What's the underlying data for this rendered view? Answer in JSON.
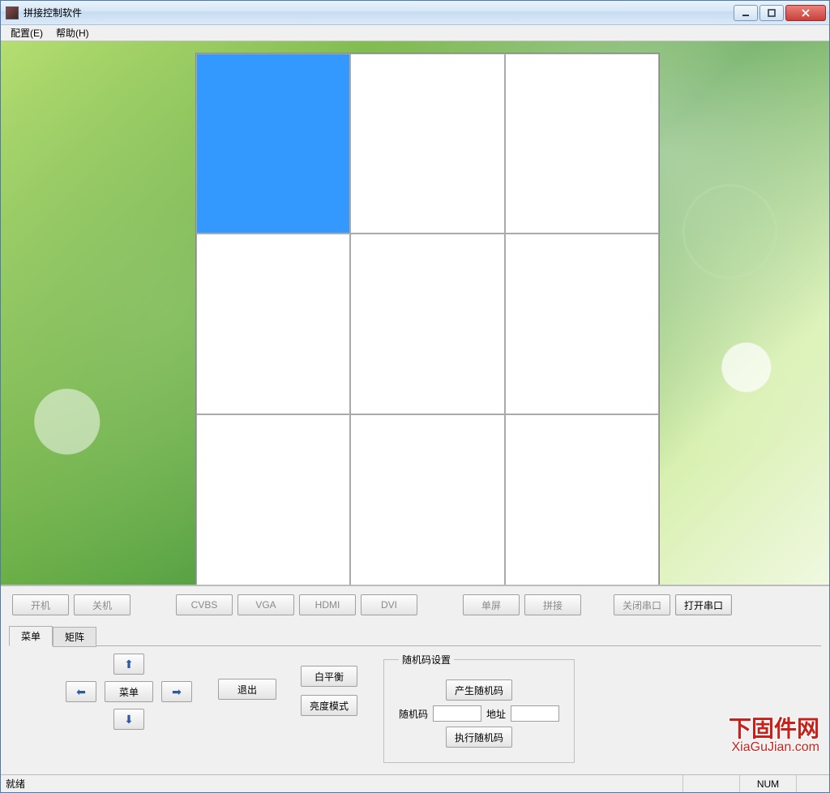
{
  "window": {
    "title": "拼接控制软件"
  },
  "menubar": {
    "config": "配置(E)",
    "help": "帮助(H)"
  },
  "grid": {
    "rows": 3,
    "cols": 3,
    "selected_index": 0
  },
  "toolbar": {
    "power_on": "开机",
    "power_off": "关机",
    "cvbs": "CVBS",
    "vga": "VGA",
    "hdmi": "HDMI",
    "dvi": "DVI",
    "single": "单屏",
    "splice": "拼接",
    "close_port": "关闭串口",
    "open_port": "打开串口"
  },
  "tabs": {
    "menu": "菜单",
    "matrix": "矩阵"
  },
  "dpad": {
    "menu": "菜单",
    "exit": "退出"
  },
  "settings": {
    "white_balance": "白平衡",
    "brightness_mode": "亮度模式"
  },
  "random": {
    "legend": "随机码设置",
    "generate": "产生随机码",
    "code_label": "随机码",
    "addr_label": "地址",
    "execute": "执行随机码",
    "code_value": "",
    "addr_value": ""
  },
  "watermark": {
    "line1": "下固件网",
    "line2": "XiaGuJian.com"
  },
  "status": {
    "ready": "就绪",
    "num": "NUM"
  }
}
